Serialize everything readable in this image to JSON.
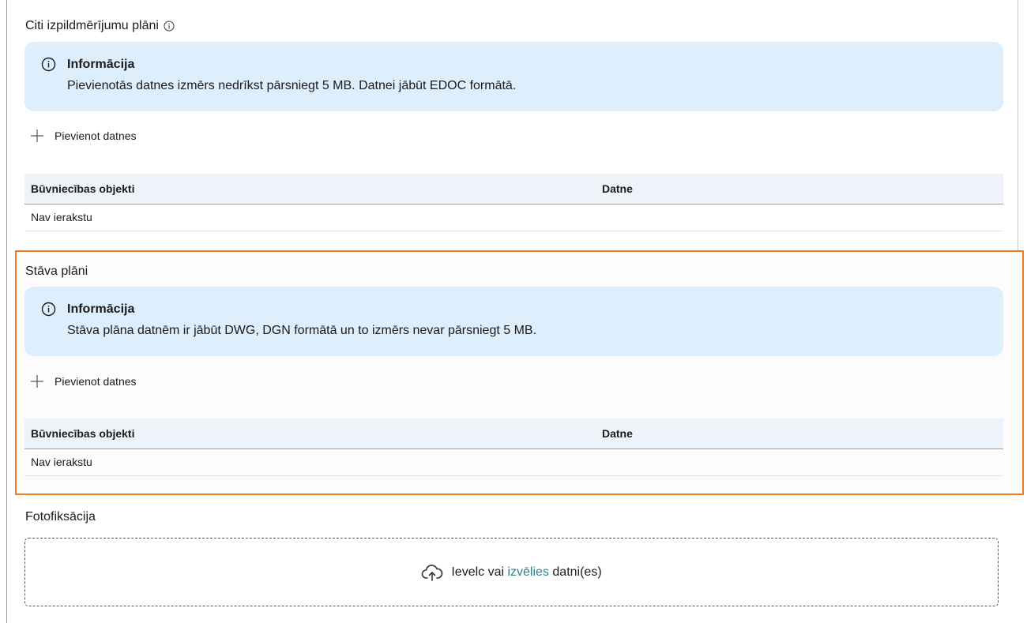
{
  "section1": {
    "title": "Citi izpildmērījumu plāni",
    "info_title": "Informācija",
    "info_text": "Pievienotās datnes izmērs nedrīkst pārsniegt 5 MB. Datnei jābūt EDOC formātā.",
    "add_label": "Pievienot datnes",
    "table": {
      "col1": "Būvniecības objekti",
      "col2": "Datne",
      "empty": "Nav ierakstu"
    }
  },
  "section2": {
    "title": "Stāva plāni",
    "info_title": "Informācija",
    "info_text": "Stāva plāna datnēm ir jābūt DWG, DGN formātā un to izmērs nevar pārsniegt 5 MB.",
    "add_label": "Pievienot datnes",
    "table": {
      "col1": "Būvniecības objekti",
      "col2": "Datne",
      "empty": "Nav ierakstu"
    }
  },
  "section3": {
    "title": "Fotofiksācija",
    "drop_prefix": "Ievelc vai ",
    "drop_link": "izvēlies",
    "drop_suffix": " datni(es)"
  },
  "colors": {
    "info_bg": "#ddeefc",
    "highlight_border": "#f07a22",
    "link": "#2d8187",
    "table_header_bg": "#eef3fa"
  },
  "icons": [
    "info-circle-icon",
    "plus-icon",
    "cloud-upload-icon"
  ]
}
